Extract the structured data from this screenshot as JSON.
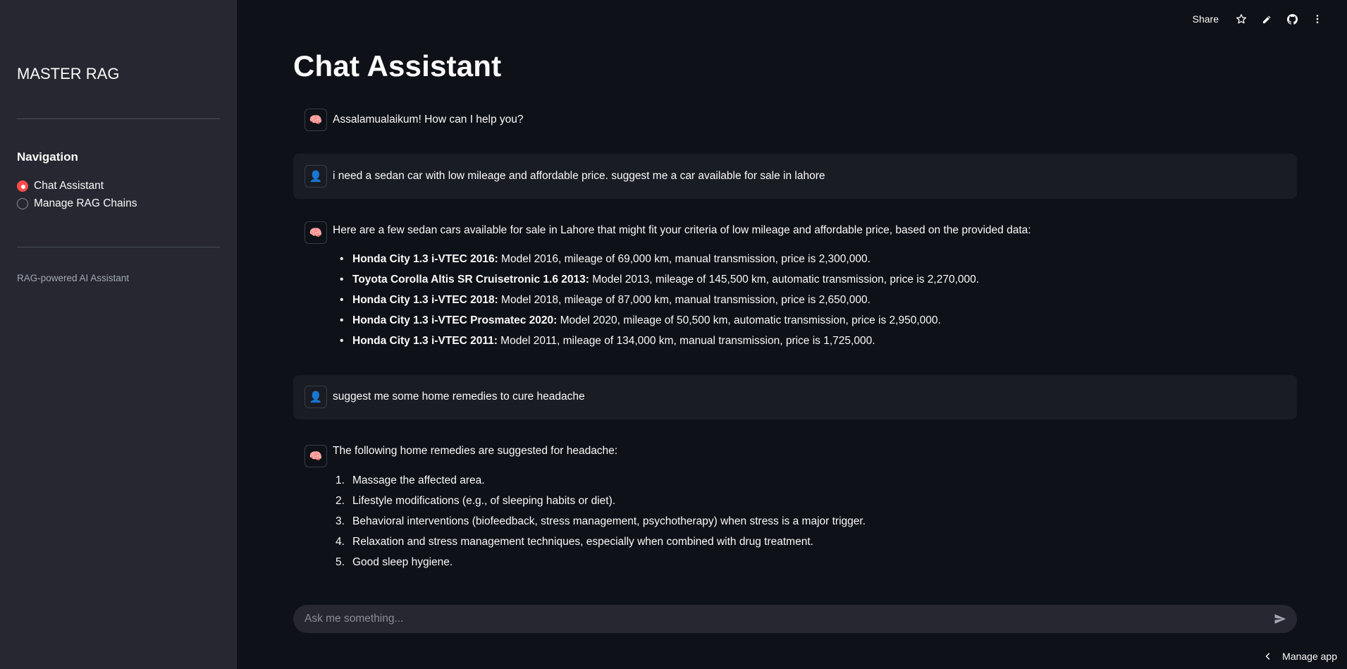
{
  "sidebar": {
    "brand": "MASTER RAG",
    "nav_title": "Navigation",
    "options": [
      {
        "label": "Chat Assistant",
        "selected": true
      },
      {
        "label": "Manage RAG Chains",
        "selected": false
      }
    ],
    "caption": "RAG-powered AI Assistant"
  },
  "topbar": {
    "share_label": "Share",
    "icons": [
      "star-icon",
      "edit-pencil-icon",
      "github-icon",
      "more-vertical-icon"
    ]
  },
  "page_title": "Chat Assistant",
  "messages": {
    "m1": {
      "role": "assistant",
      "avatar": "brain-icon",
      "text": "Assalamualaikum! How can I help you?"
    },
    "m2": {
      "role": "user",
      "avatar": "user-icon",
      "text": "i need a sedan car with low mileage and affordable price. suggest me a car available for sale in lahore"
    },
    "m3": {
      "role": "assistant",
      "avatar": "brain-icon",
      "intro": "Here are a few sedan cars available for sale in Lahore that might fit your criteria of low mileage and affordable price, based on the provided data:",
      "items": [
        {
          "bold": "Honda City 1.3 i-VTEC 2016:",
          "rest": " Model 2016, mileage of 69,000 km, manual transmission, price is 2,300,000."
        },
        {
          "bold": "Toyota Corolla Altis SR Cruisetronic 1.6 2013:",
          "rest": " Model 2013, mileage of 145,500 km, automatic transmission, price is 2,270,000."
        },
        {
          "bold": "Honda City 1.3 i-VTEC 2018:",
          "rest": " Model 2018, mileage of 87,000 km, manual transmission, price is 2,650,000."
        },
        {
          "bold": "Honda City 1.3 i-VTEC Prosmatec 2020:",
          "rest": " Model 2020, mileage of 50,500 km, automatic transmission, price is 2,950,000."
        },
        {
          "bold": "Honda City 1.3 i-VTEC 2011:",
          "rest": " Model 2011, mileage of 134,000 km, manual transmission, price is 1,725,000."
        }
      ]
    },
    "m4": {
      "role": "user",
      "avatar": "user-icon",
      "text": "suggest me some home remedies to cure headache"
    },
    "m5": {
      "role": "assistant",
      "avatar": "brain-icon",
      "intro": "The following home remedies are suggested for headache:",
      "items": [
        {
          "num": "1.",
          "text": "Massage the affected area."
        },
        {
          "num": "2.",
          "text": "Lifestyle modifications (e.g., of sleeping habits or diet)."
        },
        {
          "num": "3.",
          "text": "Behavioral interventions (biofeedback, stress management, psychotherapy) when stress is a major trigger."
        },
        {
          "num": "4.",
          "text": "Relaxation and stress management techniques, especially when combined with drug treatment."
        },
        {
          "num": "5.",
          "text": "Good sleep hygiene."
        }
      ]
    }
  },
  "chat_input": {
    "placeholder": "Ask me something...",
    "value": ""
  },
  "footer": {
    "manage_app_label": "Manage app"
  },
  "colors": {
    "accent": "#ff4b4b",
    "background": "#0e1117",
    "sidebar": "#262730"
  }
}
